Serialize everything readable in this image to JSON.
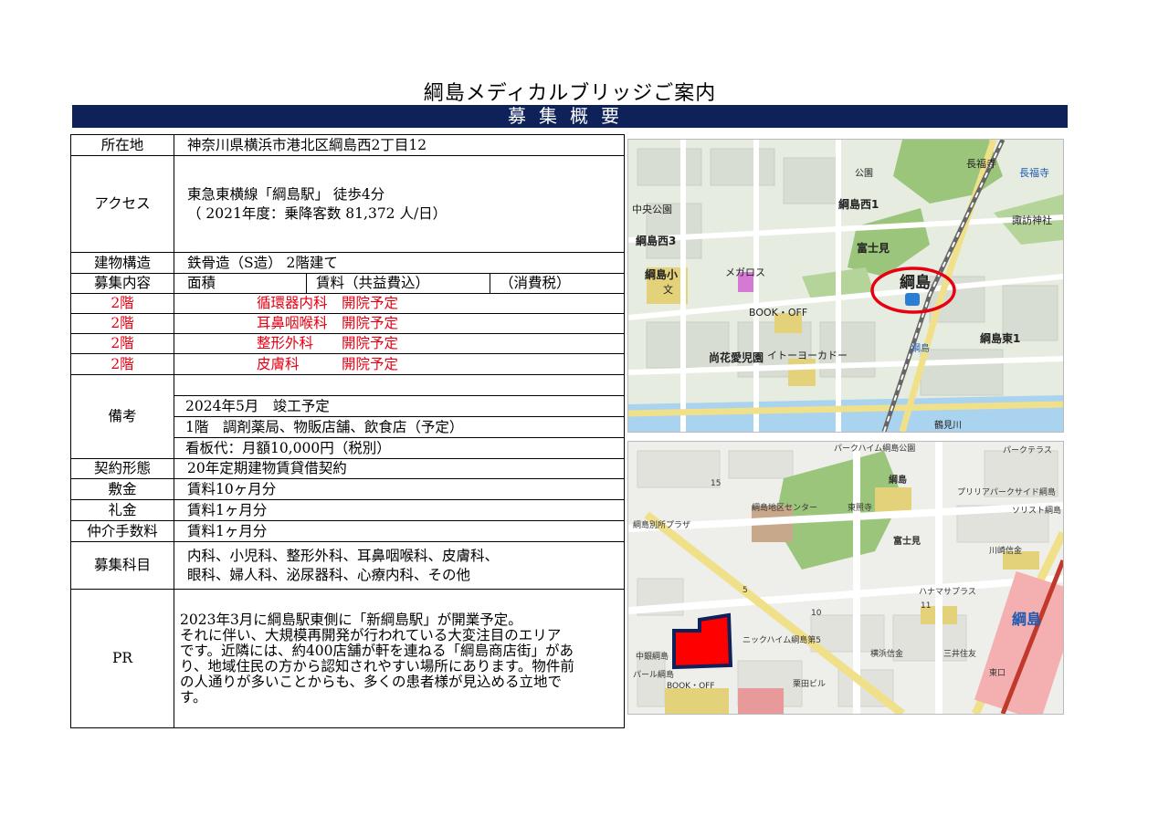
{
  "title": "綱島メディカルブリッジご案内",
  "banner": "募集概要",
  "rows": {
    "location": {
      "label": "所在地",
      "value": "神奈川県横浜市港北区綱島西2丁目12"
    },
    "access": {
      "label": "アクセス",
      "line1": "東急東横線「綱島駅」 徒歩4分",
      "line2": "（ 2021年度：乗降客数 81,372 人/日）"
    },
    "structure": {
      "label": "建物構造",
      "value": "鉄骨造（S造） 2階建て"
    },
    "recruit": {
      "label": "募集内容",
      "col1": "面積",
      "col2": "賃料（共益費込）",
      "col3": "（消費税）"
    },
    "units": [
      {
        "floor": "2階",
        "text": "循環器内科　開院予定"
      },
      {
        "floor": "2階",
        "text": "耳鼻咽喉科　開院予定"
      },
      {
        "floor": "2階",
        "text": "整形外科　　開院予定"
      },
      {
        "floor": "2階",
        "text": "皮膚科　　　開院予定"
      }
    ],
    "remarks": {
      "label": "備考",
      "lines": [
        "",
        "2024年5月　竣工予定",
        "1階　調剤薬局、物販店舗、飲食店（予定）",
        "看板代：月額10,000円（税別）"
      ]
    },
    "contract": {
      "label": "契約形態",
      "value": "20年定期建物賃貸借契約"
    },
    "deposit": {
      "label": "敷金",
      "value": "賃料10ヶ月分"
    },
    "key_money": {
      "label": "礼金",
      "value": "賃料1ヶ月分"
    },
    "brokerage": {
      "label": "仲介手数料",
      "value": "賃料1ヶ月分"
    },
    "departments": {
      "label": "募集科目",
      "line1": "内科、小児科、整形外科、耳鼻咽喉科、皮膚科、",
      "line2": "眼科、婦人科、泌尿器科、心療内科、その他"
    },
    "pr": {
      "label": "PR",
      "lines": [
        "2023年3月に綱島駅東側に「新綱島駅」が開業予定。",
        "それに伴い、大規模再開発が行われている大変注目のエリア",
        "です。近隣には、約400店舗が軒を連ねる「綱島商店街」があ",
        "り、地域住民の方から認知されやすい場所にあります。物件前",
        "の人通りが多いことからも、多くの患者様が見込める立地で",
        "す。"
      ]
    }
  },
  "map1": {
    "labels": {
      "nagafukuji": "長福寺",
      "nagafukuji_sign": "長福寺",
      "suwa": "諏訪神社",
      "chuo_park": "中央公園",
      "tsunashima_nishi1": "綱島西1",
      "tsunashima_nishi3": "綱島西3",
      "fujimi": "富士見",
      "tsunashima_big": "綱島",
      "tsunashima_sho": "綱島小",
      "megaros": "メガロス",
      "book_off": "BOOK・OFF",
      "naoka": "尚花愛児園",
      "ito_yokado": "イトーヨーカドー",
      "tsunashima_sign": "綱島",
      "tsunashima_higashi1": "綱島東1",
      "tsurumi_river": "鶴見川",
      "bunsho": "文",
      "koban": "公園"
    },
    "accent_circle": "#e60012"
  },
  "map2": {
    "labels": {
      "park_haim": "パークハイム綱島公園",
      "park_terrace": "パークテラス",
      "tsunashima": "綱島",
      "center": "綱島地区センター",
      "toshoji": "東照寺",
      "fujimi": "富士見",
      "proud": "プリリアパークサイド綱島",
      "solist": "ソリスト綱島",
      "hananasa": "ハナマサプラス",
      "kawasaki_shinkin": "川崎信金",
      "station": "綱島",
      "nikko": "ニックハイム綱島第5",
      "book_off": "BOOK・OFF",
      "mitsui": "三井住友",
      "yokohama_shinkin": "横浜信金",
      "higashiguchi": "東口",
      "tsunashima_betsu": "綱島別所プラザ",
      "pearl": "パール綱島",
      "naka": "中銀綱島",
      "kuri": "栗田ビル",
      "num_15": "15",
      "num_10": "10",
      "num_11": "11",
      "num_5": "5"
    },
    "property_color": "#ff0000",
    "property_border": "#0e2158"
  }
}
